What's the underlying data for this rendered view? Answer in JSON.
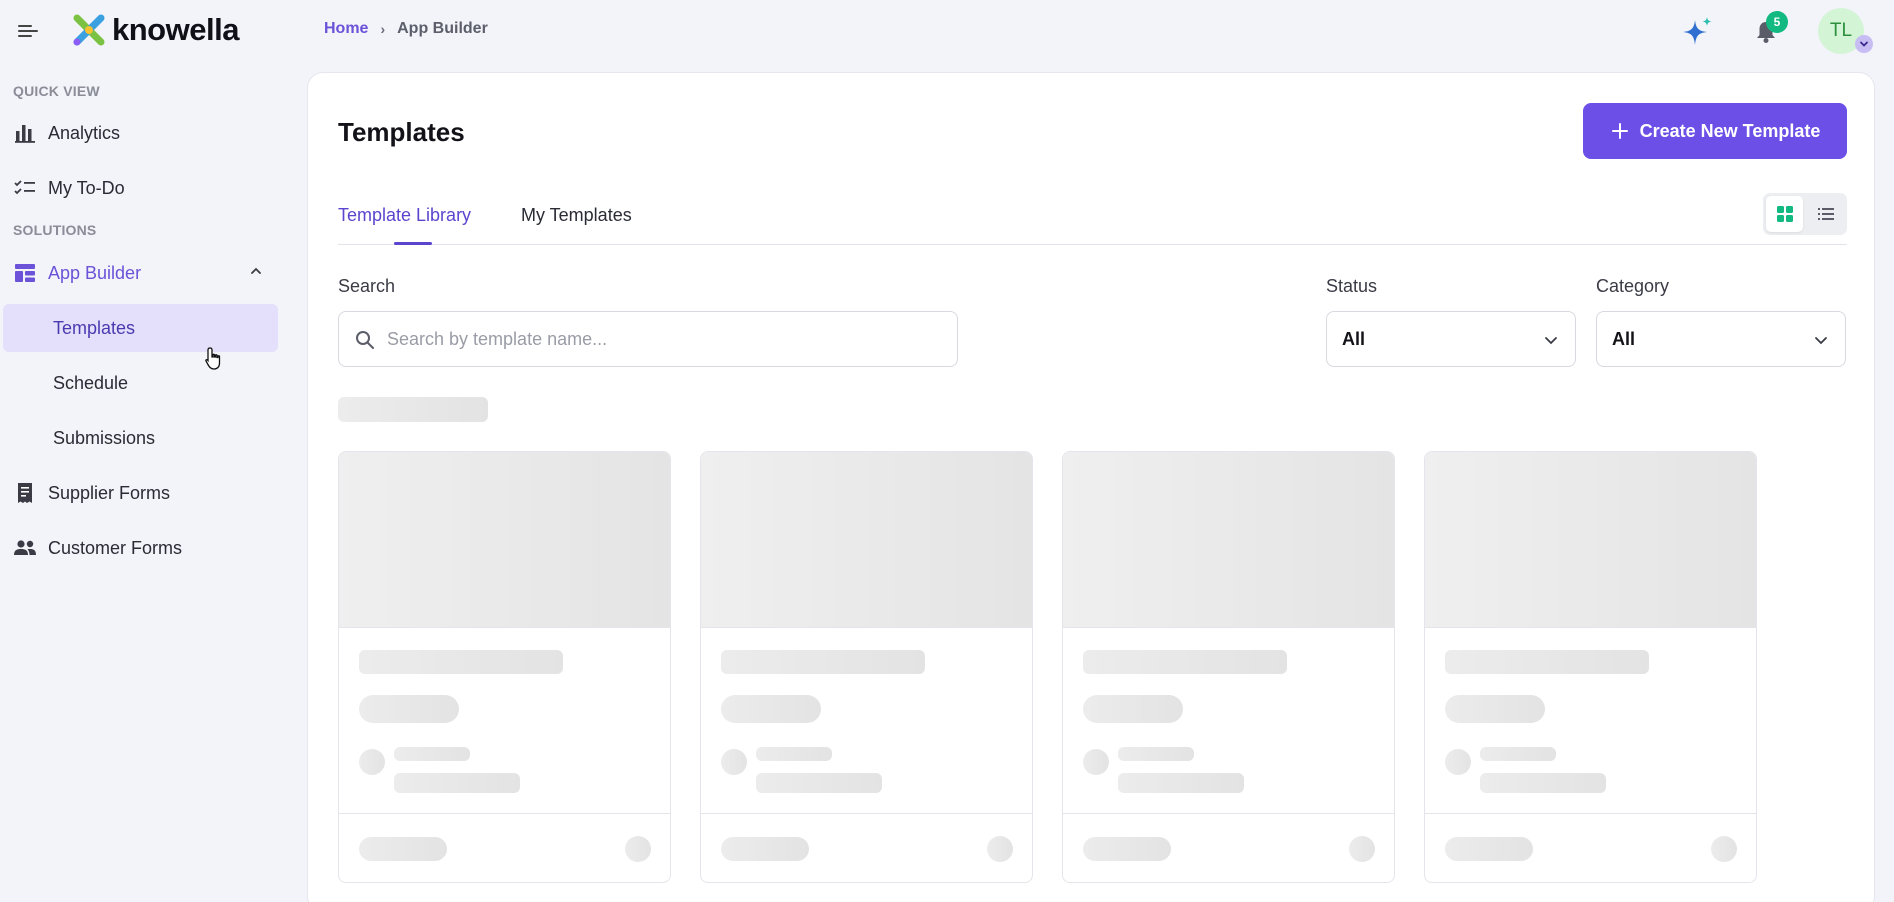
{
  "brand": {
    "name": "knowella"
  },
  "breadcrumb": {
    "home": "Home",
    "separator": "›",
    "current": "App Builder"
  },
  "header": {
    "notification_count": "5",
    "avatar_initials": "TL"
  },
  "sidebar": {
    "sections": [
      "QUICK VIEW",
      "SOLUTIONS"
    ],
    "items": [
      {
        "label": "Analytics",
        "icon": "bar-chart-icon"
      },
      {
        "label": "My To-Do",
        "icon": "checklist-icon"
      },
      {
        "label": "App Builder",
        "icon": "dashboard-icon",
        "expanded": true
      },
      {
        "label": "Templates",
        "selected": true
      },
      {
        "label": "Schedule"
      },
      {
        "label": "Submissions"
      },
      {
        "label": "Supplier Forms",
        "icon": "receipt-icon"
      },
      {
        "label": "Customer Forms",
        "icon": "people-icon"
      }
    ]
  },
  "main": {
    "title": "Templates",
    "create_button": "Create New Template",
    "tabs": [
      {
        "label": "Template Library",
        "active": true
      },
      {
        "label": "My Templates",
        "active": false
      }
    ],
    "view_mode": "grid",
    "search": {
      "label": "Search",
      "placeholder": "Search by template name...",
      "value": ""
    },
    "filters": {
      "status": {
        "label": "Status",
        "value": "All"
      },
      "category": {
        "label": "Category",
        "value": "All"
      }
    },
    "loading": true,
    "skeleton_card_count": 4
  },
  "colors": {
    "accent": "#6c4fe6",
    "badge": "#12b981",
    "selected_bg": "#e4e0fb"
  }
}
